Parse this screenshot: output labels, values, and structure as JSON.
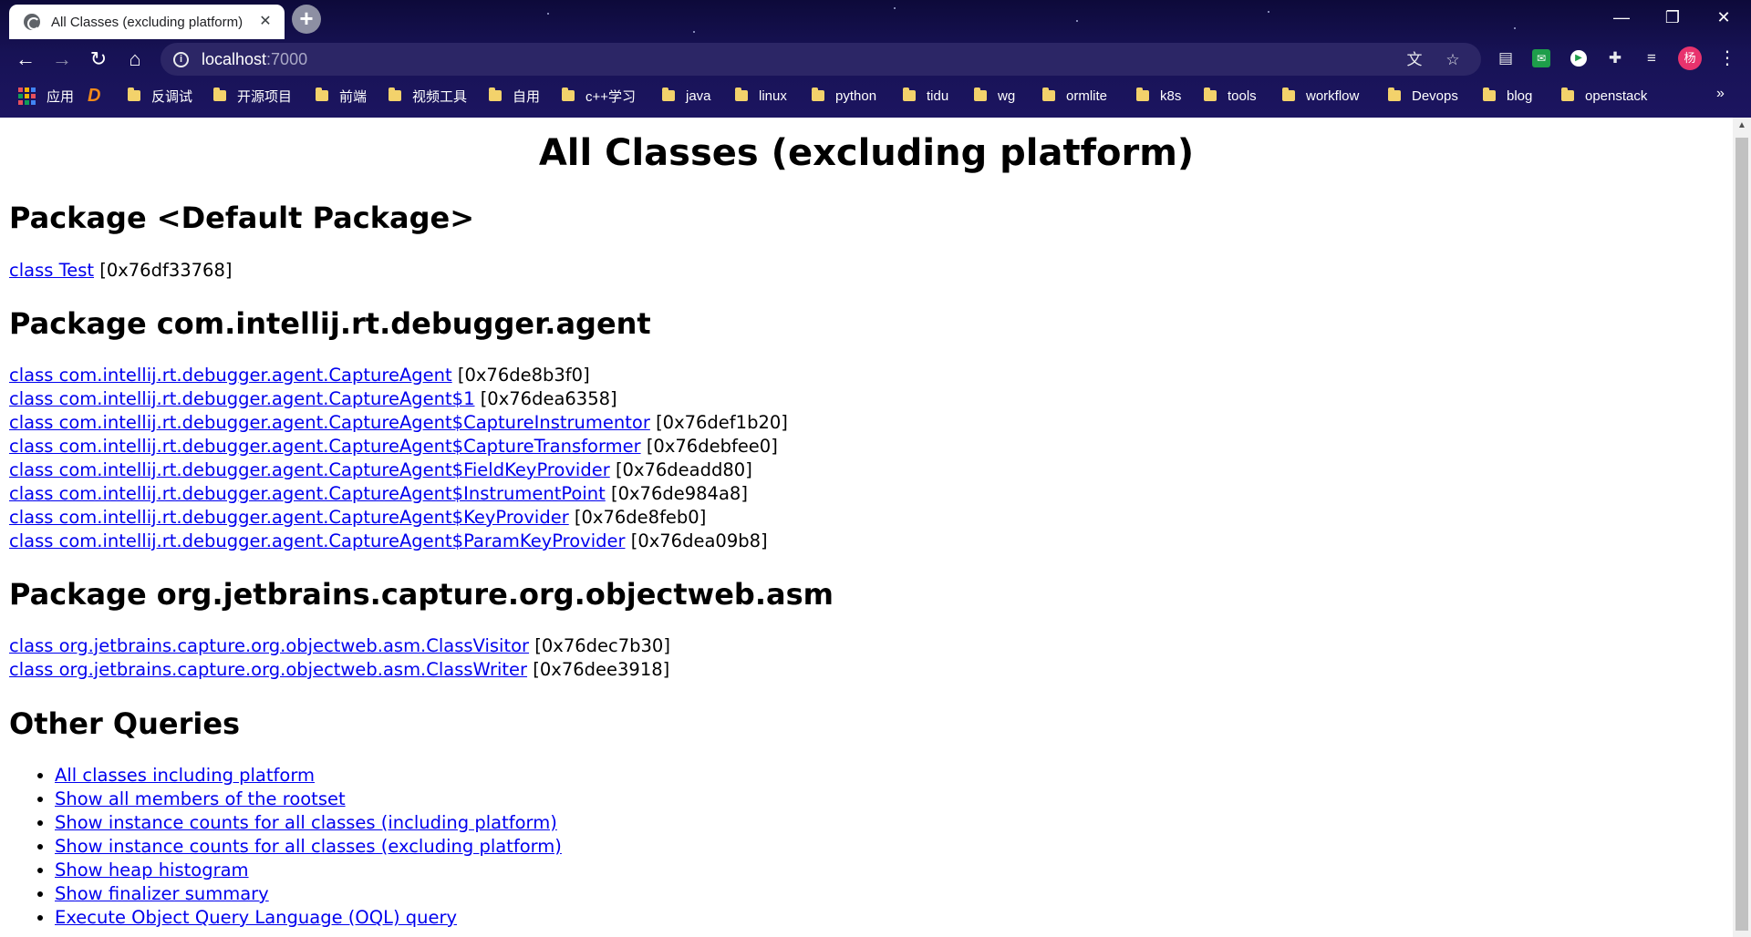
{
  "browser": {
    "tab_title": "All Classes (excluding platform)",
    "tab_close_label": "✕",
    "new_tab_label": "+",
    "window_controls": {
      "minimize": "—",
      "restore": "❐",
      "close": "✕"
    },
    "address": {
      "host": "localhost",
      "port": ":7000",
      "info_icon": "i"
    },
    "avatar_label": "杨",
    "menu_label": "⋮",
    "bookmarks": {
      "apps_label": "应用",
      "items": [
        "反调试",
        "开源项目",
        "前端",
        "视频工具",
        "自用",
        "c++学习",
        "java",
        "linux",
        "python",
        "tidu",
        "wg",
        "ormlite",
        "k8s",
        "tools",
        "workflow",
        "Devops",
        "blog",
        "openstack"
      ],
      "more_label": "»"
    }
  },
  "page": {
    "title": "All Classes (excluding platform)",
    "packages": [
      {
        "heading": "Package <Default Package>",
        "classes": [
          {
            "link": "class Test",
            "addr": "[0x76df33768]"
          }
        ]
      },
      {
        "heading": "Package com.intellij.rt.debugger.agent",
        "classes": [
          {
            "link": "class com.intellij.rt.debugger.agent.CaptureAgent",
            "addr": "[0x76de8b3f0]"
          },
          {
            "link": "class com.intellij.rt.debugger.agent.CaptureAgent$1",
            "addr": "[0x76dea6358]"
          },
          {
            "link": "class com.intellij.rt.debugger.agent.CaptureAgent$CaptureInstrumentor",
            "addr": "[0x76def1b20]"
          },
          {
            "link": "class com.intellij.rt.debugger.agent.CaptureAgent$CaptureTransformer",
            "addr": "[0x76debfee0]"
          },
          {
            "link": "class com.intellij.rt.debugger.agent.CaptureAgent$FieldKeyProvider",
            "addr": "[0x76deadd80]"
          },
          {
            "link": "class com.intellij.rt.debugger.agent.CaptureAgent$InstrumentPoint",
            "addr": "[0x76de984a8]"
          },
          {
            "link": "class com.intellij.rt.debugger.agent.CaptureAgent$KeyProvider",
            "addr": "[0x76de8feb0]"
          },
          {
            "link": "class com.intellij.rt.debugger.agent.CaptureAgent$ParamKeyProvider",
            "addr": "[0x76dea09b8]"
          }
        ]
      },
      {
        "heading": "Package org.jetbrains.capture.org.objectweb.asm",
        "classes": [
          {
            "link": "class org.jetbrains.capture.org.objectweb.asm.ClassVisitor",
            "addr": "[0x76dec7b30]"
          },
          {
            "link": "class org.jetbrains.capture.org.objectweb.asm.ClassWriter",
            "addr": "[0x76dee3918]"
          }
        ]
      }
    ],
    "other_queries": {
      "heading": "Other Queries",
      "links": [
        "All classes including platform",
        "Show all members of the rootset",
        "Show instance counts for all classes (including platform)",
        "Show instance counts for all classes (excluding platform)",
        "Show heap histogram",
        "Show finalizer summary",
        "Execute Object Query Language (OQL) query"
      ]
    }
  }
}
